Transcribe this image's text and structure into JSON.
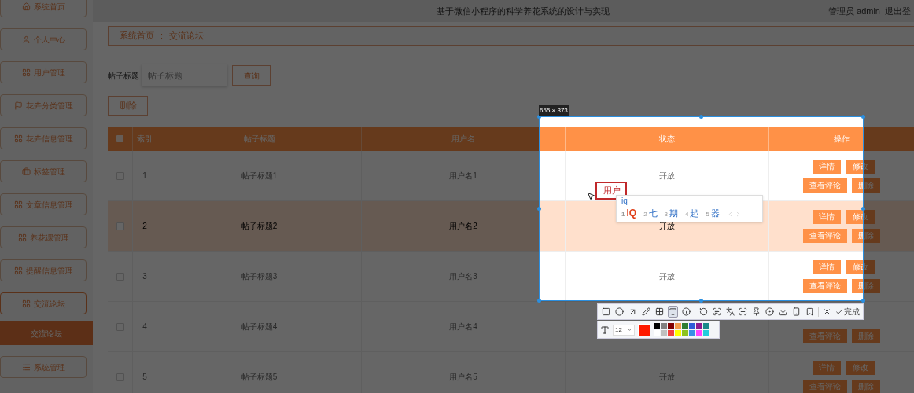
{
  "header": {
    "title": "基于微信小程序的科学养花系统的设计与实现",
    "user": "管理员 admin",
    "logout": "退出登"
  },
  "sidebar": {
    "items": [
      {
        "label": "系统首页",
        "kind": "home",
        "expanded": false
      },
      {
        "label": "个人中心",
        "kind": "user",
        "expanded": false
      },
      {
        "label": "用户管理",
        "kind": "grid",
        "expanded": false
      },
      {
        "label": "花卉分类管理",
        "kind": "flag",
        "expanded": false
      },
      {
        "label": "花卉信息管理",
        "kind": "grid",
        "expanded": false
      },
      {
        "label": "标签管理",
        "kind": "bag",
        "expanded": false
      },
      {
        "label": "文章信息管理",
        "kind": "grid",
        "expanded": false
      },
      {
        "label": "养花课管理",
        "kind": "grid",
        "expanded": false
      },
      {
        "label": "提醒信息管理",
        "kind": "grid",
        "expanded": false
      },
      {
        "label": "交流论坛",
        "kind": "grid",
        "expanded": true,
        "children": [
          {
            "label": "交流论坛",
            "selected": true
          }
        ]
      },
      {
        "label": "系统管理",
        "kind": "menu",
        "expanded": false
      }
    ]
  },
  "breadcrumb": {
    "items": [
      "系统首页",
      "交流论坛"
    ],
    "separator": ":"
  },
  "search": {
    "label": "帖子标题",
    "placeholder": "帖子标题",
    "button": "查询"
  },
  "delete_button": "删除",
  "table": {
    "select_all_checked": false,
    "columns": [
      "索引",
      "帖子标题",
      "用户名",
      "状态",
      "操作"
    ],
    "rows": [
      {
        "index": "1",
        "title": "帖子标题1",
        "user": "用户名1",
        "status": "开放",
        "selected": false,
        "checked": false,
        "actions": [
          "详情",
          "修改",
          "查看评论",
          "删除"
        ]
      },
      {
        "index": "2",
        "title": "帖子标题2",
        "user": "用户名2",
        "status": "开放",
        "selected": true,
        "checked": false,
        "actions": [
          "详情",
          "修改",
          "查看评论",
          "删除"
        ]
      },
      {
        "index": "3",
        "title": "帖子标题3",
        "user": "用户名3",
        "status": "开放",
        "selected": false,
        "checked": false,
        "actions": [
          "详情",
          "修改",
          "查看评论",
          "删除"
        ]
      },
      {
        "index": "4",
        "title": "帖子标题4",
        "user": "用户名4",
        "selected": false,
        "checked": false,
        "actions": [
          "查看评论",
          "删除"
        ]
      },
      {
        "index": "5",
        "title": "帖子标题5",
        "user": "用户名5",
        "status": "开放",
        "selected": false,
        "checked": false,
        "actions": [
          "详情",
          "修改",
          "查看评论",
          "删除"
        ]
      }
    ]
  },
  "screenshot_tool": {
    "size": "655 × 373",
    "annotation": "用户",
    "ime": {
      "input": "iq",
      "candidates": [
        {
          "num": "1",
          "text": "IQ",
          "selected": true
        },
        {
          "num": "2",
          "text": "七",
          "selected": false
        },
        {
          "num": "3",
          "text": "期",
          "selected": false
        },
        {
          "num": "4",
          "text": "起",
          "selected": false
        },
        {
          "num": "5",
          "text": "器",
          "selected": false
        }
      ]
    },
    "tools": [
      {
        "kind": "rect",
        "selected": false
      },
      {
        "kind": "ellipse",
        "selected": false
      },
      {
        "kind": "arrow",
        "selected": false
      },
      {
        "kind": "pen",
        "selected": false
      },
      {
        "kind": "mosaic",
        "selected": false
      },
      {
        "kind": "text",
        "selected": true
      },
      {
        "kind": "number",
        "selected": false
      },
      {
        "kind": "sep"
      },
      {
        "kind": "undo",
        "selected": false
      },
      {
        "kind": "ocr",
        "selected": false
      },
      {
        "kind": "translate",
        "selected": false
      },
      {
        "kind": "scroll",
        "selected": false
      },
      {
        "kind": "pin",
        "selected": false
      },
      {
        "kind": "record",
        "selected": false
      },
      {
        "kind": "save",
        "selected": false
      },
      {
        "kind": "phone",
        "selected": false
      },
      {
        "kind": "bookmark",
        "selected": false
      },
      {
        "kind": "sep"
      },
      {
        "kind": "cancel",
        "selected": false
      }
    ],
    "done": "完成",
    "font_size": "12",
    "color": "#ff1a00",
    "palette": [
      {
        "color": "#000000"
      },
      {
        "color": "#808080"
      },
      {
        "color": "#800000"
      },
      {
        "color": "#f39c4c"
      },
      {
        "color": "#2e7d32"
      },
      {
        "color": "#2e5bd8"
      },
      {
        "color": "#8e1a8e"
      },
      {
        "color": "#1a8a8a"
      },
      {
        "color": "#ffffff"
      },
      {
        "color": "#c0c0c0"
      },
      {
        "color": "#f04040"
      },
      {
        "color": "#ffff00"
      },
      {
        "color": "#8dc21f"
      },
      {
        "color": "#3a8ee6"
      },
      {
        "color": "#ff44ff"
      },
      {
        "color": "#22ccdd"
      }
    ]
  }
}
